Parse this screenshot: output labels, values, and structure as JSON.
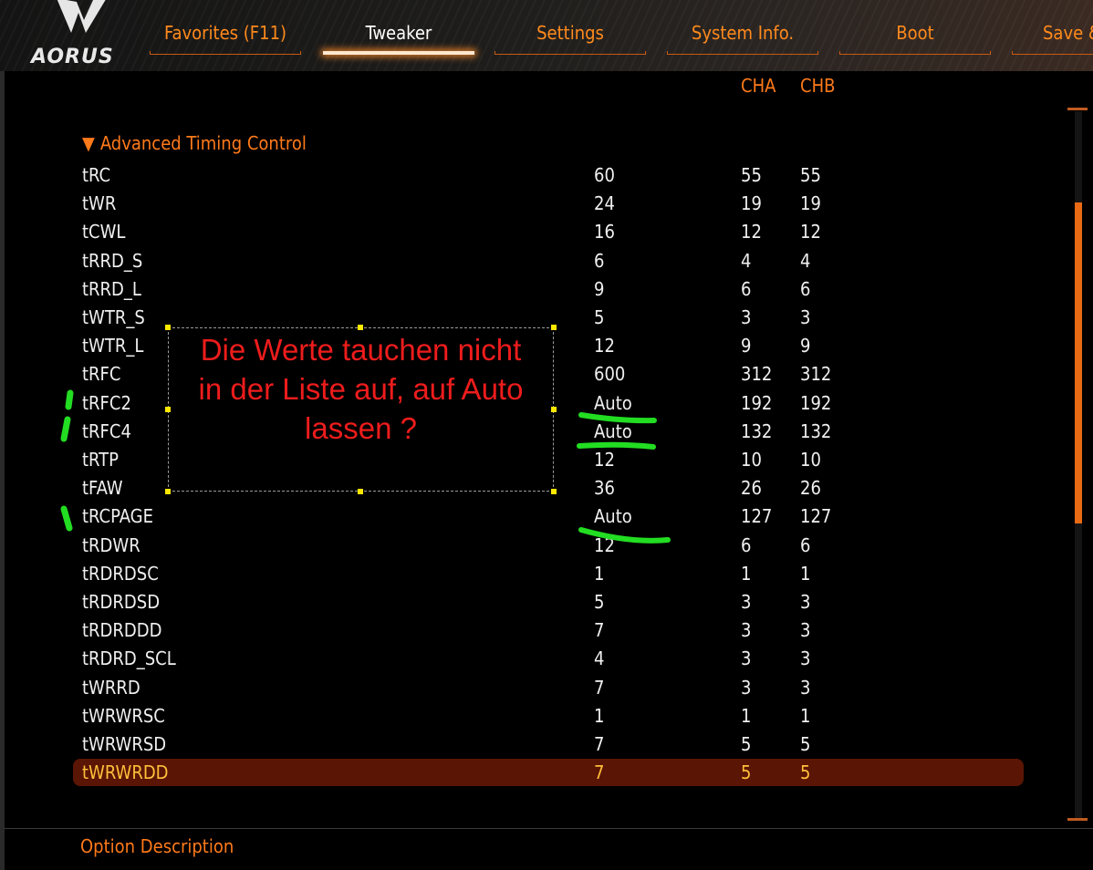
{
  "brand": {
    "logo_text": "AORUS"
  },
  "tabs": [
    {
      "label": "Favorites (F11)",
      "active": false
    },
    {
      "label": "Tweaker",
      "active": true
    },
    {
      "label": "Settings",
      "active": false
    },
    {
      "label": "System Info.",
      "active": false
    },
    {
      "label": "Boot",
      "active": false
    },
    {
      "label": "Save &",
      "active": false
    }
  ],
  "columns": {
    "cha": "CHA",
    "chb": "CHB"
  },
  "section": {
    "arrow": "▼",
    "title": "Advanced Timing Control"
  },
  "rows": [
    {
      "name": "tRC",
      "value": "60",
      "cha": "55",
      "chb": "55"
    },
    {
      "name": "tWR",
      "value": "24",
      "cha": "19",
      "chb": "19"
    },
    {
      "name": "tCWL",
      "value": "16",
      "cha": "12",
      "chb": "12"
    },
    {
      "name": "tRRD_S",
      "value": "6",
      "cha": "4",
      "chb": "4"
    },
    {
      "name": "tRRD_L",
      "value": "9",
      "cha": "6",
      "chb": "6"
    },
    {
      "name": "tWTR_S",
      "value": "5",
      "cha": "3",
      "chb": "3"
    },
    {
      "name": "tWTR_L",
      "value": "12",
      "cha": "9",
      "chb": "9"
    },
    {
      "name": "tRFC",
      "value": "600",
      "cha": "312",
      "chb": "312"
    },
    {
      "name": "tRFC2",
      "value": "Auto",
      "cha": "192",
      "chb": "192"
    },
    {
      "name": "tRFC4",
      "value": "Auto",
      "cha": "132",
      "chb": "132"
    },
    {
      "name": "tRTP",
      "value": "12",
      "cha": "10",
      "chb": "10"
    },
    {
      "name": "tFAW",
      "value": "36",
      "cha": "26",
      "chb": "26"
    },
    {
      "name": "tRCPAGE",
      "value": "Auto",
      "cha": "127",
      "chb": "127"
    },
    {
      "name": "tRDWR",
      "value": "12",
      "cha": "6",
      "chb": "6"
    },
    {
      "name": "tRDRDSC",
      "value": "1",
      "cha": "1",
      "chb": "1"
    },
    {
      "name": "tRDRDSD",
      "value": "5",
      "cha": "3",
      "chb": "3"
    },
    {
      "name": "tRDRDDD",
      "value": "7",
      "cha": "3",
      "chb": "3"
    },
    {
      "name": "tRDRD_SCL",
      "value": "4",
      "cha": "3",
      "chb": "3"
    },
    {
      "name": "tWRRD",
      "value": "7",
      "cha": "3",
      "chb": "3"
    },
    {
      "name": "tWRWRSC",
      "value": "1",
      "cha": "1",
      "chb": "1"
    },
    {
      "name": "tWRWRSD",
      "value": "7",
      "cha": "5",
      "chb": "5"
    },
    {
      "name": "tWRWRDD",
      "value": "7",
      "cha": "5",
      "chb": "5",
      "selected": true
    }
  ],
  "annotation": {
    "lines": [
      "Die Werte tauchen nicht",
      "in der Liste auf, auf Auto",
      "lassen ?"
    ],
    "color": "#ee1c1c",
    "highlight_color": "#22dd22"
  },
  "footer": {
    "title": "Option Description"
  },
  "colors": {
    "accent": "#ff7a1a",
    "selected_row": "#5a1505",
    "selected_text": "#ffbf3a"
  }
}
